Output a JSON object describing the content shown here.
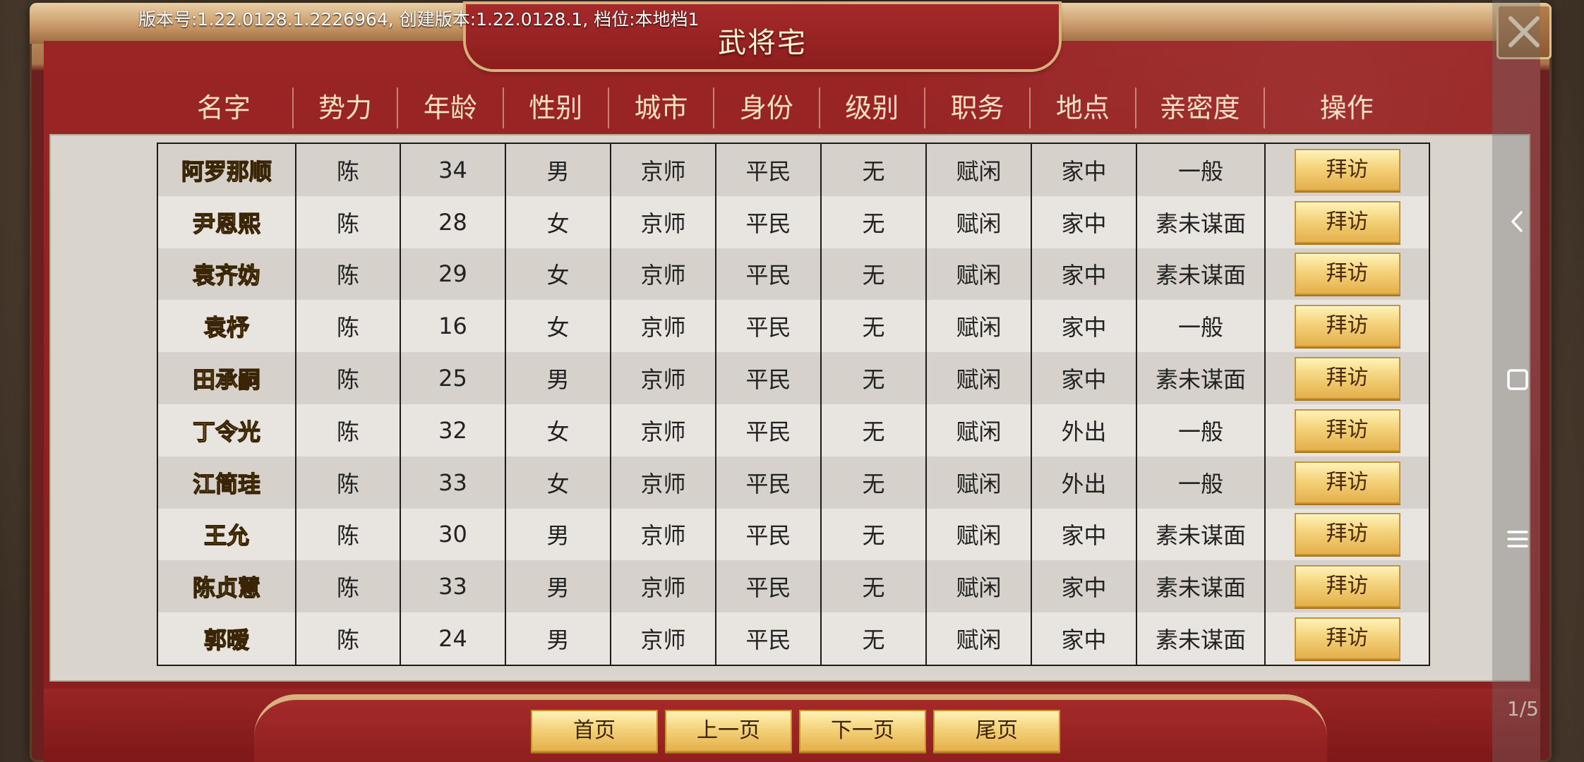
{
  "version_text": "版本号:1.22.0128.1.2226964, 创建版本:1.22.0128.1, 档位:本地档1",
  "title": "武将宅",
  "icons": {
    "close": "close-icon",
    "back": "chevron-left-icon",
    "home": "square-icon",
    "menu": "menu-icon"
  },
  "colors": {
    "panel_red": "#8a1d1d",
    "name_gold": "#f2c52a",
    "button_gold": "#f4d27a"
  },
  "columns": [
    "名字",
    "势力",
    "年龄",
    "性别",
    "城市",
    "身份",
    "级别",
    "职务",
    "地点",
    "亲密度",
    "操作"
  ],
  "rows": [
    {
      "name": "阿罗那顺",
      "faction": "陈",
      "age": "34",
      "gender": "男",
      "city": "京师",
      "status": "平民",
      "rank": "无",
      "job": "赋闲",
      "location": "家中",
      "intimacy": "一般",
      "action": "拜访"
    },
    {
      "name": "尹恩熙",
      "faction": "陈",
      "age": "28",
      "gender": "女",
      "city": "京师",
      "status": "平民",
      "rank": "无",
      "job": "赋闲",
      "location": "家中",
      "intimacy": "素未谋面",
      "action": "拜访"
    },
    {
      "name": "袁齐妫",
      "faction": "陈",
      "age": "29",
      "gender": "女",
      "city": "京师",
      "status": "平民",
      "rank": "无",
      "job": "赋闲",
      "location": "家中",
      "intimacy": "素未谋面",
      "action": "拜访"
    },
    {
      "name": "袁杼",
      "faction": "陈",
      "age": "16",
      "gender": "女",
      "city": "京师",
      "status": "平民",
      "rank": "无",
      "job": "赋闲",
      "location": "家中",
      "intimacy": "一般",
      "action": "拜访"
    },
    {
      "name": "田承嗣",
      "faction": "陈",
      "age": "25",
      "gender": "男",
      "city": "京师",
      "status": "平民",
      "rank": "无",
      "job": "赋闲",
      "location": "家中",
      "intimacy": "素未谋面",
      "action": "拜访"
    },
    {
      "name": "丁令光",
      "faction": "陈",
      "age": "32",
      "gender": "女",
      "city": "京师",
      "status": "平民",
      "rank": "无",
      "job": "赋闲",
      "location": "外出",
      "intimacy": "一般",
      "action": "拜访"
    },
    {
      "name": "江简珪",
      "faction": "陈",
      "age": "33",
      "gender": "女",
      "city": "京师",
      "status": "平民",
      "rank": "无",
      "job": "赋闲",
      "location": "外出",
      "intimacy": "一般",
      "action": "拜访"
    },
    {
      "name": "王允",
      "faction": "陈",
      "age": "30",
      "gender": "男",
      "city": "京师",
      "status": "平民",
      "rank": "无",
      "job": "赋闲",
      "location": "家中",
      "intimacy": "素未谋面",
      "action": "拜访"
    },
    {
      "name": "陈贞慧",
      "faction": "陈",
      "age": "33",
      "gender": "男",
      "city": "京师",
      "status": "平民",
      "rank": "无",
      "job": "赋闲",
      "location": "家中",
      "intimacy": "素未谋面",
      "action": "拜访"
    },
    {
      "name": "郭暧",
      "faction": "陈",
      "age": "24",
      "gender": "男",
      "city": "京师",
      "status": "平民",
      "rank": "无",
      "job": "赋闲",
      "location": "家中",
      "intimacy": "素未谋面",
      "action": "拜访"
    }
  ],
  "pager": {
    "first": "首页",
    "prev": "上一页",
    "next": "下一页",
    "last": "尾页",
    "indicator": "1/5"
  }
}
